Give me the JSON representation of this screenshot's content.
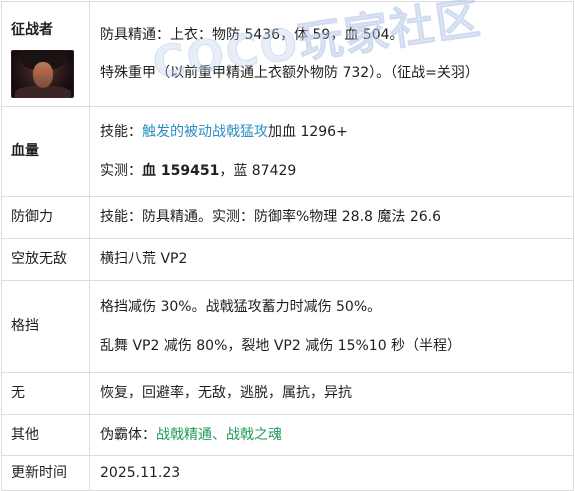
{
  "rows": {
    "zhengzhan": {
      "label": "征战者",
      "line1": "防具精通：上衣：物防 5436，体 59，血 504。",
      "line2": "特殊重甲（以前重甲精通上衣额外物防 732）。（征战=关羽）"
    },
    "hp": {
      "label": "血量",
      "skill_prefix": "技能：",
      "skill_link": "触发的被动战戟猛攻",
      "skill_suffix": "加血 1296+",
      "measured_prefix": "实测：",
      "measured_hp": "血 159451",
      "measured_suffix": "，蓝 87429"
    },
    "defense": {
      "label": "防御力",
      "text": "技能：防具精通。实测：防御率%物理 28.8 魔法 26.6"
    },
    "airborne": {
      "label": "空放无敌",
      "text": "横扫八荒 VP2"
    },
    "block": {
      "label": "格挡",
      "line1": "格挡减伤 30%。战戟猛攻蓄力时减伤 50%。",
      "line2": "乱舞 VP2 减伤 80%，裂地 VP2 减伤 15%10 秒（半程）"
    },
    "none": {
      "label": "无",
      "text": "恢复，回避率，无敌，逃脱，属抗，异抗"
    },
    "other": {
      "label": "其他",
      "prefix": "伪霸体：",
      "link": "战戟精通、战戟之魂"
    },
    "updated": {
      "label": "更新时间",
      "text": "2025.11.23"
    }
  },
  "watermark": "COCO玩家社区",
  "icons": {
    "avatar": "character-portrait-icon"
  },
  "colors": {
    "link_blue": "#2a8fc0",
    "link_green": "#1f9a5c",
    "border": "#dcdcdc"
  }
}
